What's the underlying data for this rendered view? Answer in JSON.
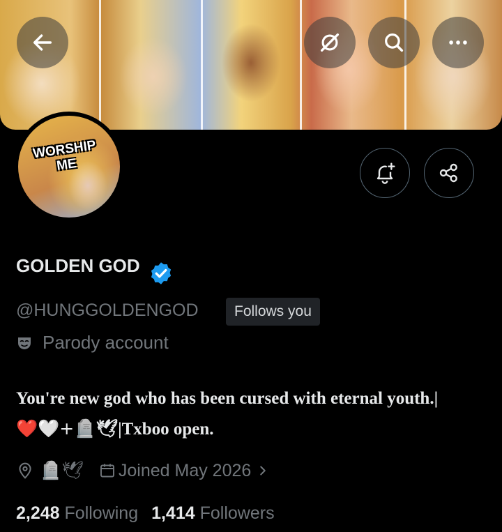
{
  "header": {
    "back_icon": "arrow-left-icon",
    "grok_icon": "grok-icon",
    "search_icon": "search-icon",
    "more_icon": "more-icon"
  },
  "profile": {
    "avatar_text": "WORSHIP ME",
    "display_name": "GOLDEN GOD",
    "handle": "@HUNGGOLDENGOD",
    "follows_you": "Follows you",
    "parody_label": "Parody account",
    "bio_line1": "You're new god who has been cursed with eternal youth.|",
    "bio_line2_emoji": "❤️🤍+",
    "bio_line2_tail": "🪦🕊|Txboo open.",
    "location": "🪦🕊",
    "joined": "Joined May 2026",
    "following_count": "2,248",
    "following_label": "Following",
    "followers_count": "1,414",
    "followers_label": "Followers"
  },
  "colors": {
    "background": "#000000",
    "verified": "#1d9bf0",
    "muted_text": "#71767b",
    "text": "#e7e9ea"
  }
}
